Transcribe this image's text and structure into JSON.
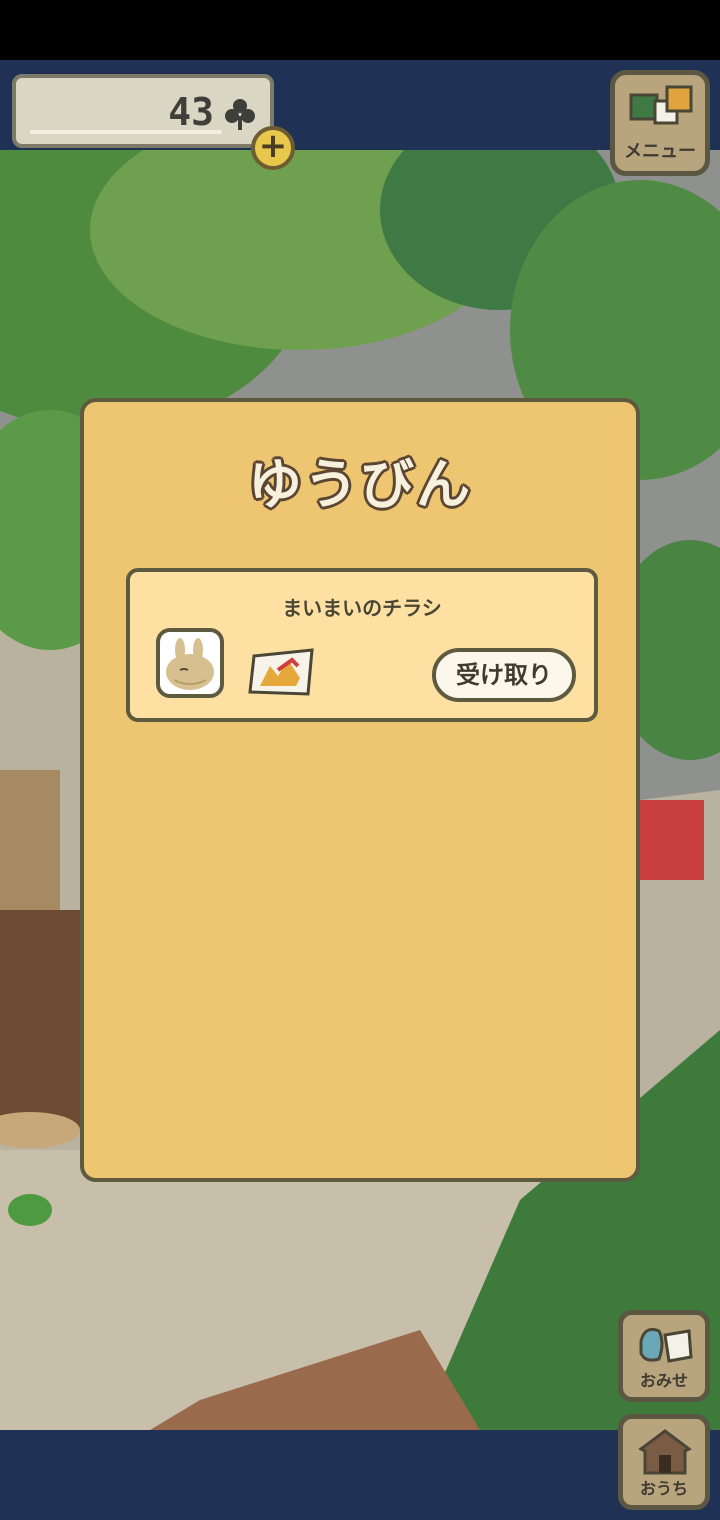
{
  "header": {
    "clover_count": "43",
    "menu_label": "メニュー"
  },
  "mail": {
    "title": "ゆうびん",
    "items": [
      {
        "sender": "まいまいのチラシ",
        "action_label": "受け取り"
      }
    ]
  },
  "side_buttons": {
    "shop_label": "おみせ",
    "home_label": "おうち"
  },
  "icons": [
    "clover-icon",
    "plus-icon",
    "menu-icon",
    "snail-avatar-icon",
    "flyer-icon",
    "shop-icon",
    "house-icon"
  ],
  "colors": {
    "band": "#1f3255",
    "panel": "#eec571",
    "card": "#fee1a2",
    "outline": "#5d5a3f"
  }
}
